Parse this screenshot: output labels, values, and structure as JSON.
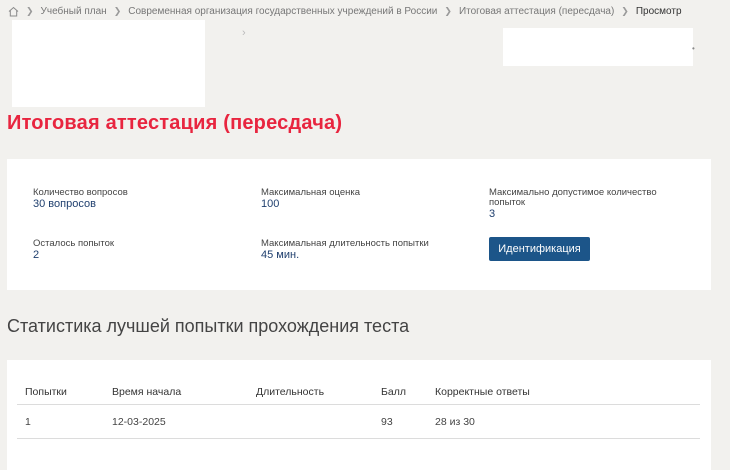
{
  "breadcrumb": {
    "items": [
      "Учебный план",
      "Современная организация государственных учреждений в России",
      "Итоговая аттестация (пересдача)",
      "Просмотр"
    ]
  },
  "page_title": "Итоговая аттестация (пересдача)",
  "info": {
    "questions_label": "Количество вопросов",
    "questions_value": "30 вопросов",
    "max_score_label": "Максимальная оценка",
    "max_score_value": "100",
    "max_attempts_label": "Максимально допустимое количество попыток",
    "max_attempts_value": "3",
    "remaining_label": "Осталось попыток",
    "remaining_value": "2",
    "max_duration_label": "Максимальная длительность попытки",
    "max_duration_value": "45 мин.",
    "ident_button_label": "Идентификация"
  },
  "stats": {
    "title": "Статистика лучшей попытки прохождения теста",
    "columns": [
      "Попытки",
      "Время начала",
      "Длительность",
      "Балл",
      "Корректные ответы"
    ],
    "rows": [
      [
        "1",
        "12-03-2025",
        "",
        "93",
        "28 из 30"
      ]
    ]
  },
  "colors": {
    "title_red": "#e8253f",
    "button_blue": "#1c5589",
    "value_blue": "#1f3f6e",
    "background": "#f2f1ee"
  }
}
